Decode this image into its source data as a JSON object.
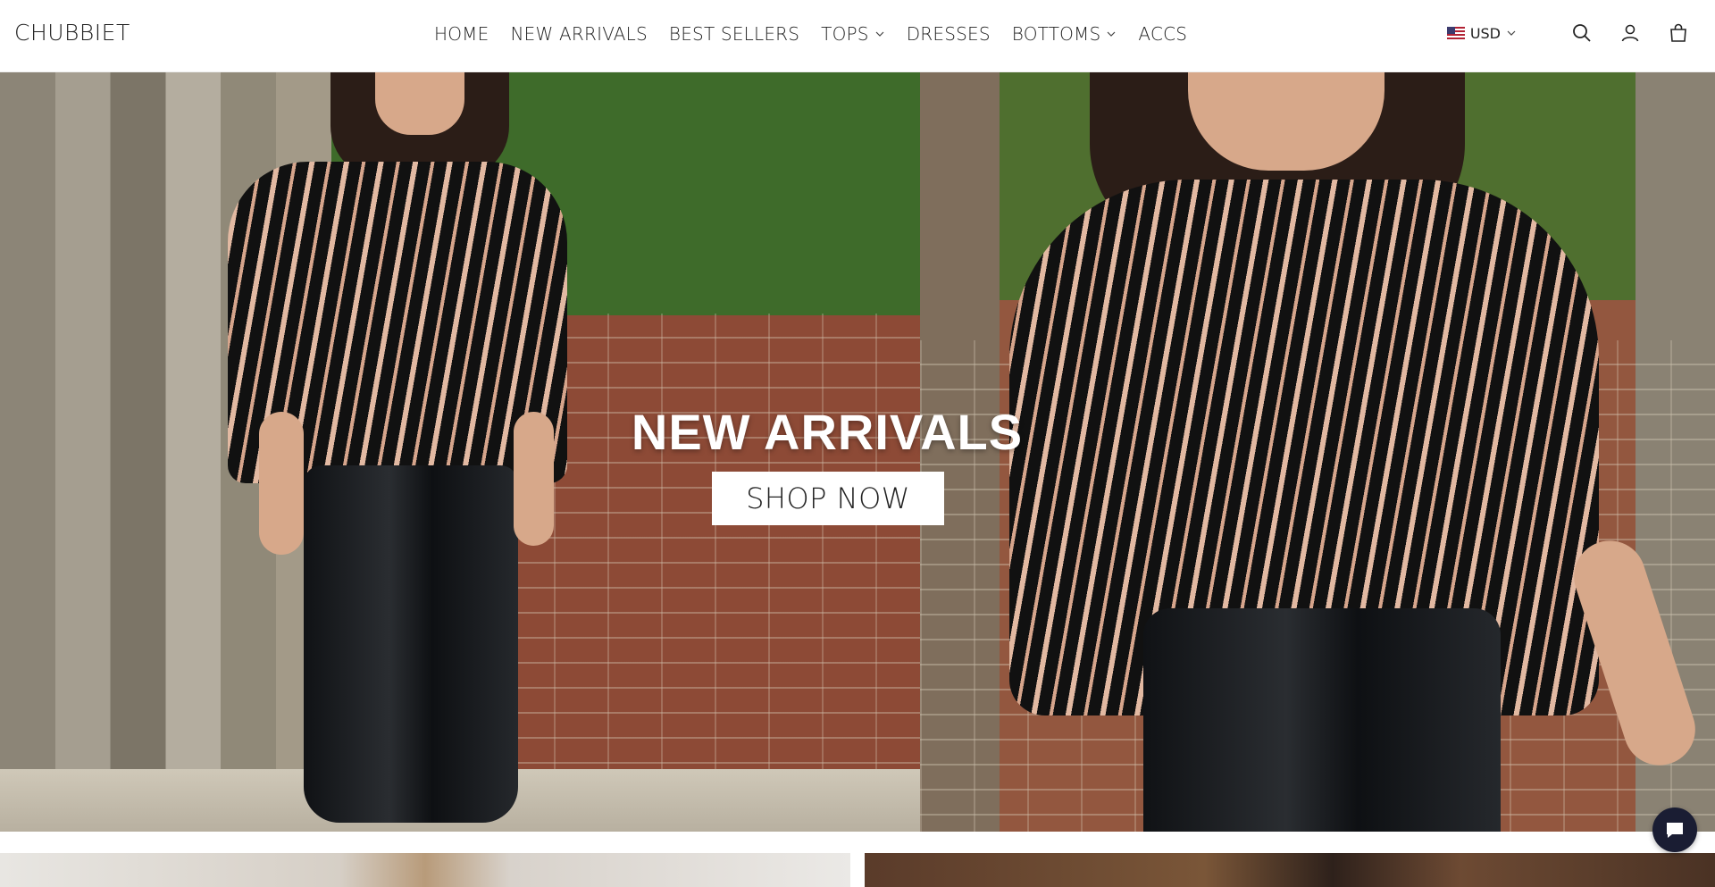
{
  "brand": {
    "logo_text": "CHUBBIET"
  },
  "nav": {
    "items": [
      {
        "label": "HOME",
        "dropdown": false
      },
      {
        "label": "NEW ARRIVALS",
        "dropdown": false
      },
      {
        "label": "BEST SELLERS",
        "dropdown": false
      },
      {
        "label": "TOPS",
        "dropdown": true
      },
      {
        "label": "DRESSES",
        "dropdown": false
      },
      {
        "label": "BOTTOMS",
        "dropdown": true
      },
      {
        "label": "ACCS",
        "dropdown": false
      }
    ]
  },
  "tools": {
    "currency": "USD",
    "currency_flag_icon": "us-flag-icon",
    "icons": [
      "search-icon",
      "account-icon",
      "cart-icon"
    ]
  },
  "hero": {
    "title": "NEW ARRIVALS",
    "cta_label": "SHOP NOW"
  },
  "chat": {
    "icon": "chat-bubble-icon"
  },
  "colors": {
    "header_bg": "#ffffff",
    "text": "#222222",
    "chat_bg": "#1a1d33",
    "cta_bg": "#ffffff"
  }
}
